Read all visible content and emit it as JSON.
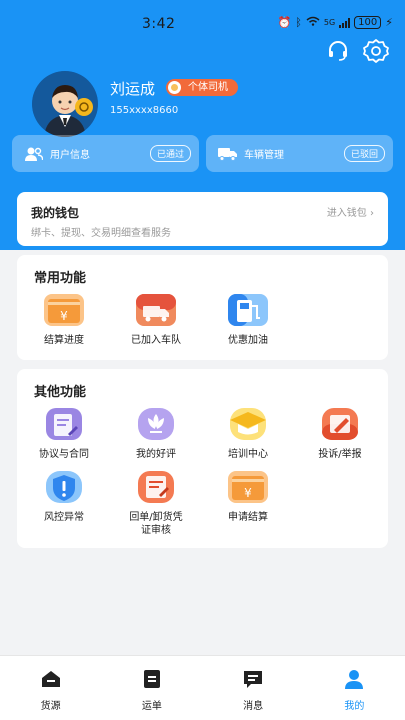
{
  "status_bar": {
    "time": "3:42",
    "network": "5G",
    "battery": "100"
  },
  "colors": {
    "primary": "#1a93f5",
    "badge": "#f26a3a",
    "background": "#f2f3f5"
  },
  "header_actions": [
    {
      "name": "headset-icon",
      "icon": "headset-icon"
    },
    {
      "name": "settings-gear-icon",
      "icon": "gear-icon"
    }
  ],
  "profile": {
    "name": "刘运成",
    "role": "个体司机",
    "phone": "155xxxx8660"
  },
  "info_cards": {
    "user": {
      "label": "用户信息",
      "status": "已通过"
    },
    "vehicle": {
      "label": "车辆管理",
      "status": "已驳回"
    }
  },
  "wallet": {
    "title": "我的钱包",
    "subtitle": "绑卡、提现、交易明细查看服务",
    "link": "进入钱包"
  },
  "common_functions": {
    "title": "常用功能",
    "items": [
      {
        "label": "结算进度",
        "icon": "settlement-icon"
      },
      {
        "label": "已加入车队",
        "icon": "truck-icon"
      },
      {
        "label": "优惠加油",
        "icon": "fuel-icon"
      }
    ]
  },
  "other_functions": {
    "title": "其他功能",
    "items": [
      {
        "label": "协议与合同",
        "icon": "contract-icon"
      },
      {
        "label": "我的好评",
        "icon": "flower-icon"
      },
      {
        "label": "培训中心",
        "icon": "graduation-cap-icon"
      },
      {
        "label": "投诉/举报",
        "icon": "complaint-icon"
      },
      {
        "label": "风控异常",
        "icon": "shield-alert-icon"
      },
      {
        "label": "回单/卸货凭证审核",
        "icon": "receipt-icon"
      },
      {
        "label": "申请结算",
        "icon": "settlement-icon"
      }
    ]
  },
  "tab_bar": {
    "active": "我的",
    "items": [
      {
        "label": "货源",
        "icon": "home-icon"
      },
      {
        "label": "运单",
        "icon": "waybill-icon"
      },
      {
        "label": "消息",
        "icon": "message-icon"
      },
      {
        "label": "我的",
        "icon": "profile-icon"
      }
    ]
  }
}
